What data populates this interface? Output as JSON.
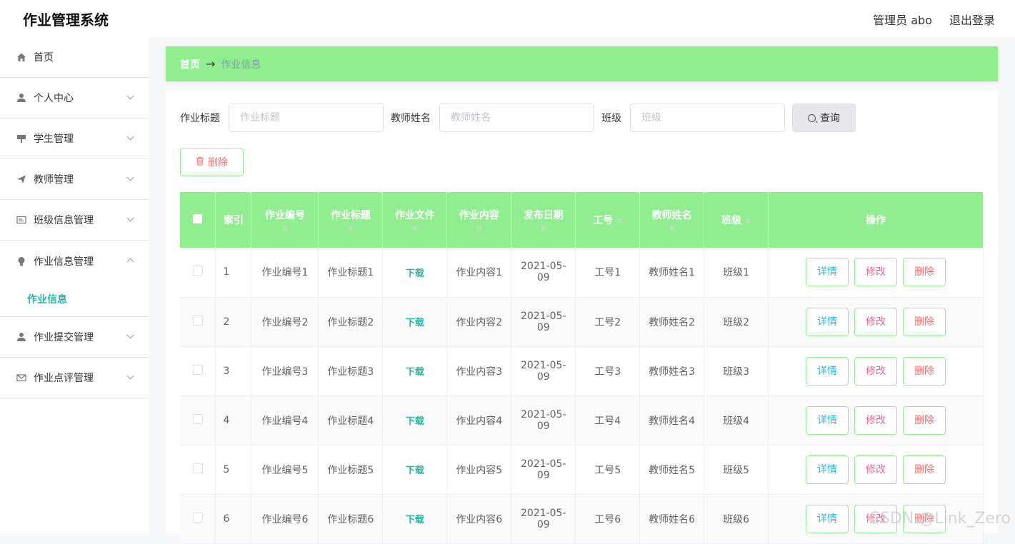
{
  "header": {
    "app_title": "作业管理系统",
    "user_label": "管理员 abo",
    "logout_label": "退出登录"
  },
  "sidebar": {
    "items": [
      {
        "label": "首页",
        "icon": "home-icon",
        "expandable": false
      },
      {
        "label": "个人中心",
        "icon": "user-icon",
        "expandable": true
      },
      {
        "label": "学生管理",
        "icon": "student-icon",
        "expandable": true
      },
      {
        "label": "教师管理",
        "icon": "send-icon",
        "expandable": true
      },
      {
        "label": "班级信息管理",
        "icon": "card-icon",
        "expandable": true
      },
      {
        "label": "作业信息管理",
        "icon": "bulb-icon",
        "expandable": true,
        "expanded": true
      },
      {
        "label": "作业提交管理",
        "icon": "user-icon",
        "expandable": true
      },
      {
        "label": "作业点评管理",
        "icon": "mail-icon",
        "expandable": true
      }
    ],
    "active_submenu": "作业信息"
  },
  "breadcrumb": {
    "home": "首页",
    "separator": "→",
    "current": "作业信息"
  },
  "search": {
    "title_label": "作业标题",
    "title_placeholder": "作业标题",
    "teacher_label": "教师姓名",
    "teacher_placeholder": "教师姓名",
    "class_label": "班级",
    "class_placeholder": "班级",
    "query_label": "查询"
  },
  "toolbar": {
    "delete_label": "删除"
  },
  "table": {
    "columns": [
      "索引",
      "作业编号",
      "作业标题",
      "作业文件",
      "作业内容",
      "发布日期",
      "工号",
      "教师姓名",
      "班级",
      "操作"
    ],
    "rows": [
      {
        "index": "1",
        "code": "作业编号1",
        "title": "作业标题1",
        "file": "下载",
        "content": "作业内容1",
        "date_a": "2021-05-",
        "date_b": "09",
        "job_no": "工号1",
        "teacher": "教师姓名1",
        "class": "班级1"
      },
      {
        "index": "2",
        "code": "作业编号2",
        "title": "作业标题2",
        "file": "下载",
        "content": "作业内容2",
        "date_a": "2021-05-",
        "date_b": "09",
        "job_no": "工号2",
        "teacher": "教师姓名2",
        "class": "班级2"
      },
      {
        "index": "3",
        "code": "作业编号3",
        "title": "作业标题3",
        "file": "下载",
        "content": "作业内容3",
        "date_a": "2021-05-",
        "date_b": "09",
        "job_no": "工号3",
        "teacher": "教师姓名3",
        "class": "班级3"
      },
      {
        "index": "4",
        "code": "作业编号4",
        "title": "作业标题4",
        "file": "下载",
        "content": "作业内容4",
        "date_a": "2021-05-",
        "date_b": "09",
        "job_no": "工号4",
        "teacher": "教师姓名4",
        "class": "班级4"
      },
      {
        "index": "5",
        "code": "作业编号5",
        "title": "作业标题5",
        "file": "下载",
        "content": "作业内容5",
        "date_a": "2021-05-",
        "date_b": "09",
        "job_no": "工号5",
        "teacher": "教师姓名5",
        "class": "班级5"
      },
      {
        "index": "6",
        "code": "作业编号6",
        "title": "作业标题6",
        "file": "下载",
        "content": "作业内容6",
        "date_a": "2021-05-",
        "date_b": "09",
        "job_no": "工号6",
        "teacher": "教师姓名6",
        "class": "班级6"
      }
    ],
    "actions": {
      "detail": "详情",
      "edit": "修改",
      "remove": "删除"
    }
  },
  "watermark": "CSDN @Link_Zero",
  "colors": {
    "accent_green": "#90ee90",
    "teal": "#2bb5a0",
    "danger": "#f56c6c"
  }
}
